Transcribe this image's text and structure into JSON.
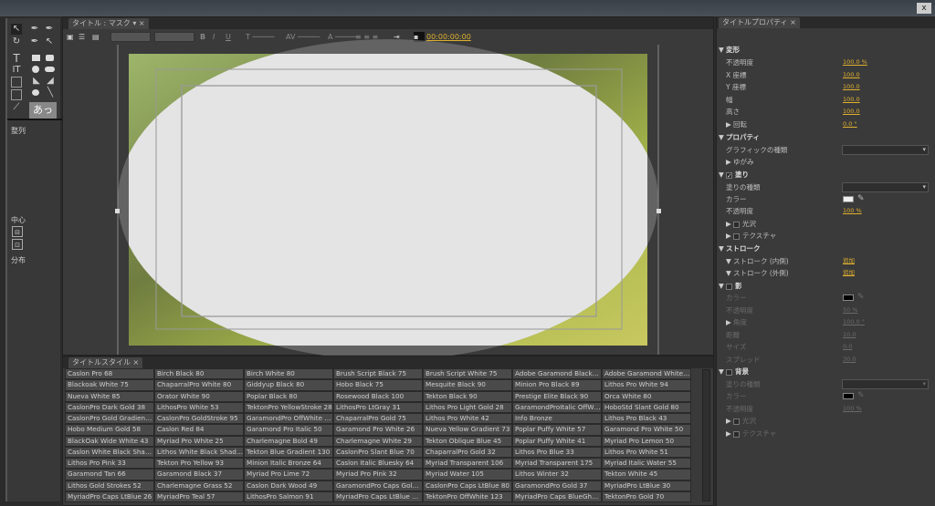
{
  "window": {
    "close_label": "x"
  },
  "tools": {
    "align_label": "整列",
    "center_label": "中心",
    "distribute_label": "分布",
    "text_tool_glyph": "T",
    "vertical_text_glyph": "IT",
    "style_sample": "あっ"
  },
  "canvas_panel": {
    "tab_label": "タイトル : マスク",
    "timecode": "00:00:00:00",
    "bold": "B",
    "italic": "I",
    "underline": "U"
  },
  "styles_panel": {
    "tab_label": "タイトルスタイル",
    "styles": [
      [
        "Caslon Pro 68",
        "Birch Black 80",
        "Birch White 80",
        "Brush Script Black 75",
        "Brush Script White 75",
        "Adobe Garamond Black 90",
        "Adobe Garamond White 90"
      ],
      [
        "Blackoak White 75",
        "ChaparralPro White 80",
        "Giddyup Black 80",
        "Hobo Black 75",
        "Mesquite Black 90",
        "Minion Pro Black 89",
        "Lithos Pro White 94"
      ],
      [
        "Nueva White 85",
        "Orator White 90",
        "Poplar Black 80",
        "Rosewood Black 100",
        "Tekton Black 90",
        "Prestige Elite Black 90",
        "Orca White 80"
      ],
      [
        "CaslonPro Dark Gold 38",
        "LithosPro White 53",
        "TektonPro YellowStroke 28",
        "LithosPro LtGray 31",
        "Lithos Pro Light Gold 28",
        "GaramondProItalic OffWh...",
        "HoboStd Slant Gold 80"
      ],
      [
        "CaslonPro Gold Gradient ...",
        "CaslonPro GoldStroke 95",
        "GaramondPro OffWhite 28",
        "ChaparralPro Gold 75",
        "Lithos Pro White 42",
        "Info Bronze",
        "Lithos Pro Black 43"
      ],
      [
        "Hobo Medium Gold 58",
        "Caslon Red 84",
        "Garamond Pro Italic 50",
        "Garamond Pro White 26",
        "Nueva Yellow Gradient 73",
        "Poplar Puffy White 57",
        "Garamond Pro White 50"
      ],
      [
        "BlackOak Wide White 43",
        "Myriad Pro White 25",
        "Charlemagne Bold 49",
        "Charlemagne White 29",
        "Tekton Oblique Blue 45",
        "Poplar Puffy White  41",
        "Myriad Pro Lemon 50"
      ],
      [
        "Caslon White Black Shado...",
        "Lithos White Black Shado...",
        "Tekton Blue Gradient 130",
        "CaslonPro Slant Blue 70",
        "ChaparralPro Gold 32",
        "Lithos Pro Blue 33",
        "Lithos Pro White 51"
      ],
      [
        "Lithos Pro Pink 33",
        "Tekton Pro Yellow 93",
        "Minion Italic Bronze 64",
        "Caslon Italic Bluesky 64",
        "Myriad Transparent 106",
        "Myriad Transparent 175",
        "Myriad Italic Water 55"
      ],
      [
        "Garamond Tan 66",
        "Garamond Black 37",
        "Myriad Pro Lime 72",
        "Myriad Pro Pink 32",
        "Myriad Water 105",
        "Lithos Winter 32",
        "Tekton White 45"
      ],
      [
        "Lithos Gold Strokes 52",
        "Charlemagne Grass 52",
        "Caslon Dark Wood 49",
        "GaramondPro Caps Gold ...",
        "CaslonPro Caps LtBlue 80",
        "GaramondPro Gold 37",
        "MyriadPro LtBlue 30"
      ],
      [
        "MyriadPro Caps LtBlue 26",
        "MyriadPro Teal 57",
        "LithosPro Salmon 91",
        "MyriadPro Caps LtBlue 105",
        "TektonPro OffWhite 123",
        "MyriadPro Caps BlueGhos...",
        "TektonPro Gold 70"
      ]
    ]
  },
  "properties": {
    "tab_label": "タイトルプロパティ",
    "transform": {
      "label": "変形",
      "opacity_label": "不透明度",
      "opacity": "100.0 %",
      "x_label": "X 座標",
      "x": "100.0",
      "y_label": "Y 座標",
      "y": "100.0",
      "width_label": "幅",
      "width": "100.0",
      "height_label": "高さ",
      "height": "100.0",
      "rotation_label": "回転",
      "rotation": "0.0 °"
    },
    "props": {
      "label": "プロパティ",
      "graphic_type_label": "グラフィックの種類",
      "distort_label": "ゆがみ"
    },
    "fill": {
      "label": "塗り",
      "checked": true,
      "fill_type_label": "塗りの種類",
      "color_label": "カラー",
      "color": "#f0f0f0",
      "opacity_label": "不透明度",
      "opacity": "100 %",
      "sheen_label": "光沢",
      "texture_label": "テクスチャ"
    },
    "stroke": {
      "label": "ストローク",
      "inner_label": "ストローク (内側)",
      "inner_add": "追加",
      "outer_label": "ストローク (外側)",
      "outer_add": "追加"
    },
    "shadow": {
      "label": "影",
      "checked": false,
      "color_label": "カラー",
      "color": "#000000",
      "opacity_label": "不透明度",
      "opacity": "50 %",
      "angle_label": "角度",
      "angle": "100.0 °",
      "distance_label": "距離",
      "distance": "10.0",
      "size_label": "サイズ",
      "size": "0.0",
      "spread_label": "スプレッド",
      "spread": "30.0"
    },
    "background": {
      "label": "背景",
      "checked": false,
      "fill_type_label": "塗りの種類",
      "color_label": "カラー",
      "color": "#000000",
      "opacity_label": "不透明度",
      "opacity": "100 %",
      "sheen_label": "光沢",
      "texture_label": "テクスチャ"
    }
  },
  "colors": {
    "accent": "#e0b030",
    "mask_fill": "#e4e4e4"
  }
}
